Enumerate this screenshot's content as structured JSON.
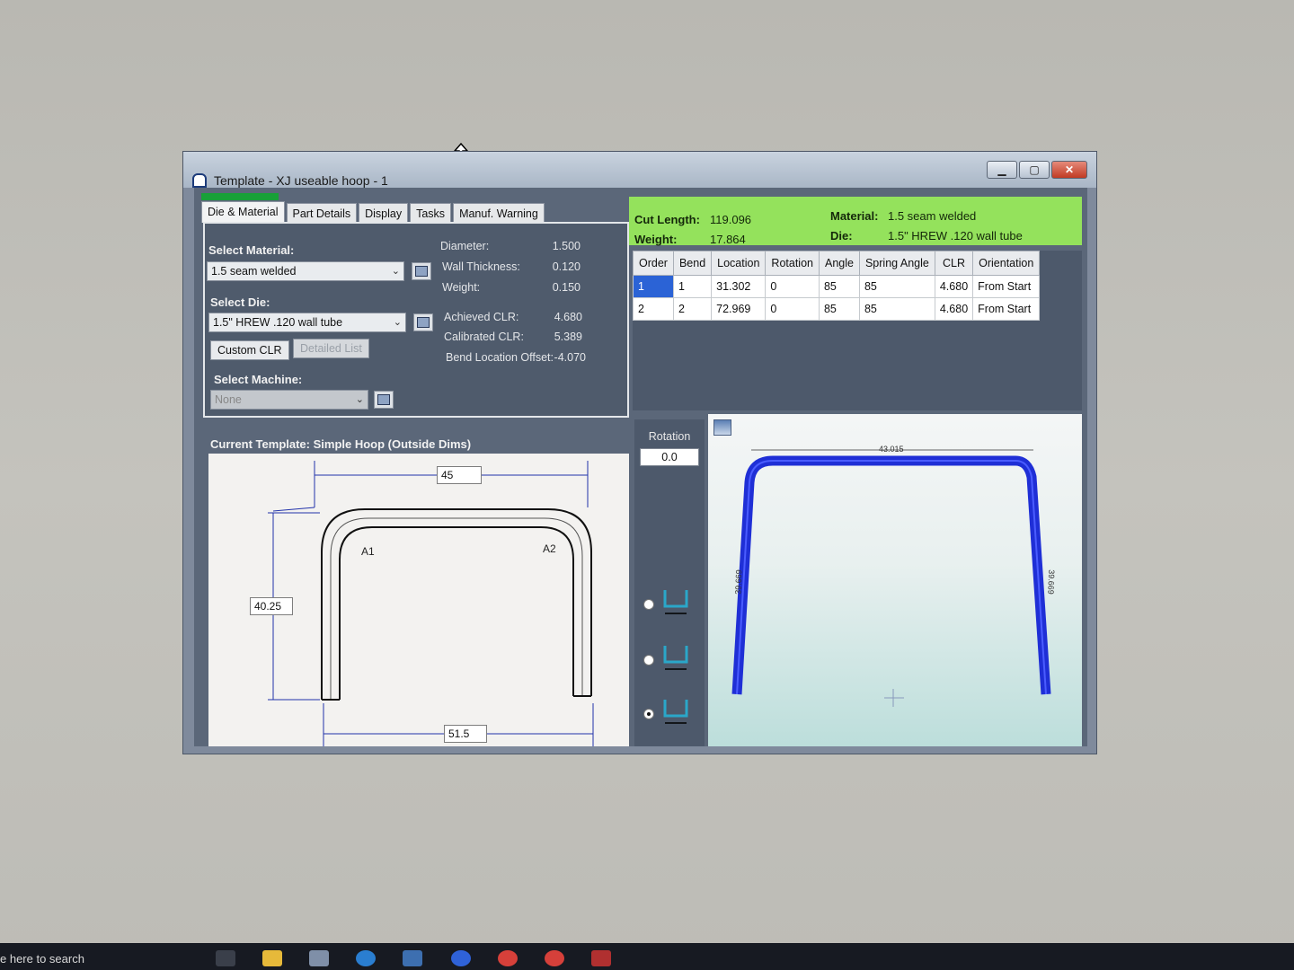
{
  "window": {
    "title": "Template - XJ useable hoop - 1",
    "controls": {
      "minimize": "▁",
      "maximize": "▢",
      "close": "✕"
    }
  },
  "tabs": [
    "Die & Material",
    "Part Details",
    "Display",
    "Tasks",
    "Manuf. Warning"
  ],
  "die_material": {
    "select_material_label": "Select Material:",
    "material_value": "1.5 seam welded",
    "select_die_label": "Select Die:",
    "die_value": "1.5\" HREW .120 wall tube",
    "custom_clr_label": "Custom CLR",
    "detailed_list_label": "Detailed List",
    "select_machine_label": "Select Machine:",
    "machine_value": "None",
    "specs": [
      {
        "label": "Diameter:",
        "value": "1.500"
      },
      {
        "label": "Wall Thickness:",
        "value": "0.120"
      },
      {
        "label": "Weight:",
        "value": "0.150"
      },
      {
        "label": "Achieved CLR:",
        "value": "4.680"
      },
      {
        "label": "Calibrated CLR:",
        "value": "5.389"
      },
      {
        "label": "Bend Location Offset:",
        "value": "-4.070"
      }
    ]
  },
  "template": {
    "title": "Current Template: Simple Hoop (Outside Dims)",
    "dim_top": "45",
    "dim_left": "40.25",
    "dim_bottom": "51.5",
    "bend1": "A1",
    "bend2": "A2"
  },
  "summary": {
    "cut_length_label": "Cut Length:",
    "cut_length_value": "119.096",
    "weight_label": "Weight:",
    "weight_value": "17.864",
    "material_label": "Material:",
    "material_value": "1.5 seam welded",
    "die_label": "Die:",
    "die_value": "1.5\" HREW .120 wall tube"
  },
  "bend_table": {
    "columns": [
      "Order",
      "Bend",
      "Location",
      "Rotation",
      "Angle",
      "Spring Angle",
      "CLR",
      "Orientation"
    ],
    "rows": [
      [
        "1",
        "1",
        "31.302",
        "0",
        "85",
        "85",
        "4.680",
        "From Start"
      ],
      [
        "2",
        "2",
        "72.969",
        "0",
        "85",
        "85",
        "4.680",
        "From Start"
      ]
    ]
  },
  "rotation": {
    "label": "Rotation",
    "value": "0.0"
  },
  "view3d": {
    "top_dim": "43.015",
    "left_dim": "39.669",
    "right_dim": "39.669"
  },
  "colors": {
    "summary_bg": "#94e25c",
    "tube": "#1f2fd6",
    "selection": "#2b63d6"
  },
  "taskbar": {
    "search_text": "e here to search"
  }
}
